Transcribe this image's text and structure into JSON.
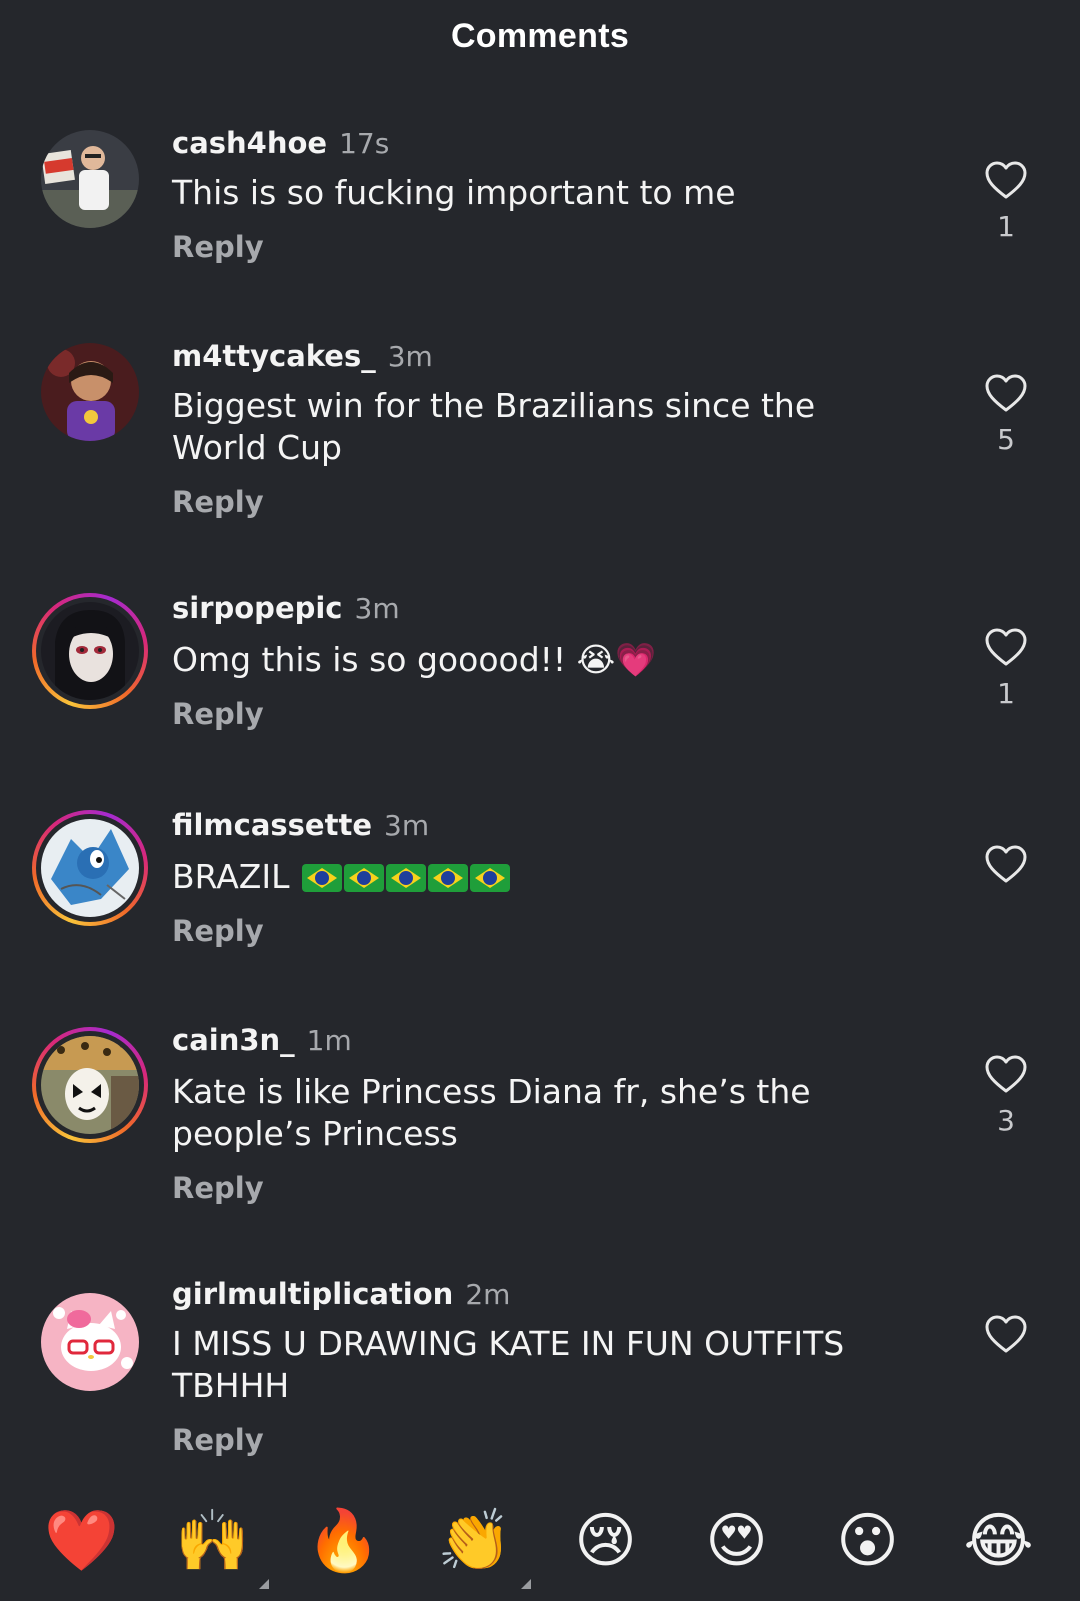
{
  "header": {
    "title": "Comments"
  },
  "comments": [
    {
      "username": "cash4hoe",
      "time": "17s",
      "text": "This is so fucking important to me",
      "reply": "Reply",
      "likes": "1",
      "avatar_ring": false,
      "avatar": "man-holding-strike-sign"
    },
    {
      "username": "m4ttycakes_",
      "time": "3m",
      "text": "Biggest win for the Brazilians since the World Cup",
      "reply": "Reply",
      "likes": "5",
      "avatar_ring": false,
      "avatar": "child-purple-shirt"
    },
    {
      "username": "sirpopepic",
      "time": "3m",
      "text": "Omg this is so gooood!! 😭💗",
      "reply": "Reply",
      "likes": "1",
      "avatar_ring": true,
      "avatar": "pale-face-dark-hair"
    },
    {
      "username": "filmcassette",
      "time": "3m",
      "text": "BRAZIL",
      "text_flags": 5,
      "reply": "Reply",
      "likes": "",
      "avatar_ring": true,
      "avatar": "blue-cartoon-hedgehog"
    },
    {
      "username": "cain3n_",
      "time": "1m",
      "text": "Kate is like Princess Diana fr, she’s the people’s Princess",
      "reply": "Reply",
      "likes": "3",
      "avatar_ring": true,
      "avatar": "face-paint-leopard-hat"
    },
    {
      "username": "girlmultiplication",
      "time": "2m",
      "text": "I MISS U DRAWING KATE IN FUN  OUTFITS TBHHH",
      "reply": "Reply",
      "likes": "",
      "avatar_ring": false,
      "avatar": "pink-cartoon-kitty"
    }
  ],
  "emoji_bar": [
    {
      "emoji": "❤️",
      "name": "red-heart-emoji",
      "has_variants": false
    },
    {
      "emoji": "🙌",
      "name": "raising-hands-emoji",
      "has_variants": true
    },
    {
      "emoji": "🔥",
      "name": "fire-emoji",
      "has_variants": false
    },
    {
      "emoji": "👏",
      "name": "clapping-hands-emoji",
      "has_variants": true
    },
    {
      "emoji": "😢",
      "name": "crying-face-emoji",
      "has_variants": false
    },
    {
      "emoji": "😍",
      "name": "heart-eyes-emoji",
      "has_variants": false
    },
    {
      "emoji": "😮",
      "name": "open-mouth-emoji",
      "has_variants": false
    },
    {
      "emoji": "😂",
      "name": "tears-of-joy-emoji",
      "has_variants": false
    }
  ],
  "colors": {
    "background": "#25272c",
    "text_primary": "#f4f4f4",
    "text_secondary": "#a7a9ad",
    "story_ring": "#d8287a"
  }
}
